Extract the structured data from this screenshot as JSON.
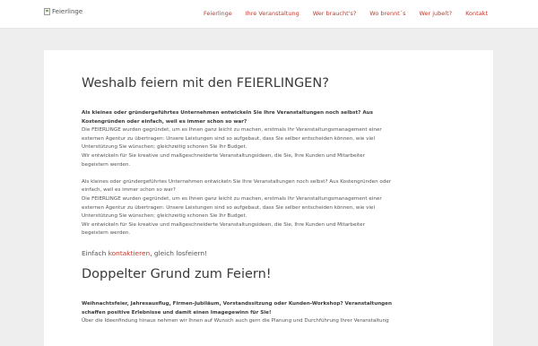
{
  "header": {
    "logo_alt": "Feierlinge",
    "nav": [
      "Feierlinge",
      "Ihre Veranstaltung",
      "Wer braucht's?",
      "Wo brennt´s",
      "Wer jubelt?",
      "Kontakt"
    ]
  },
  "section1": {
    "title": "Weshalb feiern mit den FEIERLINGEN?",
    "intro_bold": [
      "Als kleines oder gründergeführtes Unternehmen entwickeln Sie Ihre Veranstaltungen noch selbst? Aus",
      "Kostengründen oder einfach, weil es immer schon so war?"
    ],
    "para1": [
      "Die FEIERLINGE wurden gegründet, um es Ihnen ganz leicht zu machen, erstmals Ihr Veranstaltungsmanagement einer",
      "externen Agentur zu übertragen: Unsere Leistungen sind so aufgebaut, dass Sie selber entscheiden können, wie viel",
      "Unterstützung Sie wünschen; gleichzeitig schonen Sie Ihr Budget.",
      "Wir entwickeln für Sie kreative und maßgeschneiderte Veranstaltungsideen, die Sie, Ihre Kunden und Mitarbeiter",
      "begeistern werden."
    ],
    "para2": [
      "Als kleines oder gründergeführtes Unternehmen entwickeln Sie Ihre Veranstaltungen noch selbst? Aus Kostengründen oder",
      "einfach, weil es immer schon so war?",
      "Die FEIERLINGE wurden gegründet, um es Ihnen ganz leicht zu machen, erstmals Ihr Veranstaltungsmanagement einer",
      "externen Agentur zu übertragen: Unsere Leistungen sind so aufgebaut, dass Sie selber entscheiden können, wie viel",
      "Unterstützung Sie wünschen; gleichzeitig schonen Sie Ihr Budget.",
      "Wir entwickeln für Sie kreative und maßgeschneiderte Veranstaltungsideen, die Sie, Ihre Kunden und Mitarbeiter",
      "begeistern werden."
    ],
    "cta_prefix": "Einfach ",
    "cta_link": "kontaktieren",
    "cta_suffix": ", gleich losfeiern!"
  },
  "section2": {
    "title": "Doppelter Grund zum Feiern!",
    "intro_bold": [
      "Weihnachtsfeier, Jahresausflug, Firmen-Jubiläum, Vorstandssitzung oder Kunden-Workshop? Veranstaltungen",
      "schaffen positive Erlebnisse und damit einen Imagegewinn für Sie!"
    ],
    "para1": [
      "Über die Ideenfindung hinaus nehmen wir Ihnen auf Wunsch auch gern die Planung und Durchführung Ihrer Veranstaltung"
    ]
  },
  "colors": {
    "accent": "#c0392b",
    "heading": "#3a3a3a",
    "text": "#555555",
    "page_bg": "#eeeeee"
  }
}
